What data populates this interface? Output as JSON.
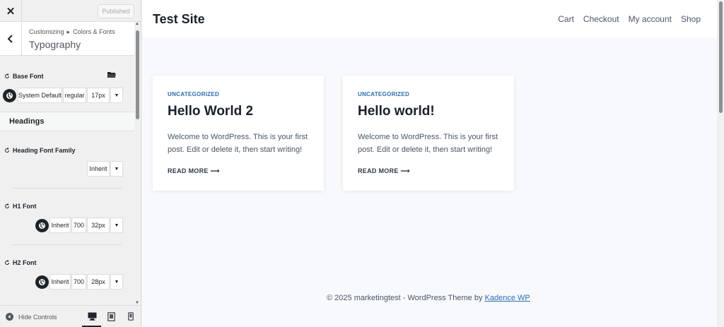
{
  "topbar": {
    "close_glyph": "✕",
    "publish_label": "Published"
  },
  "panel": {
    "breadcrumb_root": "Customizing",
    "breadcrumb_sep": "▸",
    "breadcrumb_parent": "Colors & Fonts",
    "section_title": "Typography"
  },
  "base_font": {
    "label": "Base Font",
    "family": "System Default",
    "weight": "regular",
    "size": "17px"
  },
  "headings": {
    "title": "Headings",
    "family_label": "Heading Font Family",
    "family_value": "Inherit",
    "h1": {
      "label": "H1 Font",
      "family": "Inherit",
      "weight": "700",
      "size": "32px"
    },
    "h2": {
      "label": "H2 Font",
      "family": "Inherit",
      "weight": "700",
      "size": "28px"
    }
  },
  "footer_controls": {
    "hide_label": "Hide Controls"
  },
  "site": {
    "title": "Test Site",
    "nav": [
      "Cart",
      "Checkout",
      "My account",
      "Shop"
    ]
  },
  "posts": [
    {
      "category": "UNCATEGORIZED",
      "title": "Hello World 2",
      "excerpt": "Welcome to WordPress. This is your first post. Edit or delete it, then start writing!",
      "read_more": "READ MORE ⟶"
    },
    {
      "category": "UNCATEGORIZED",
      "title": "Hello world!",
      "excerpt": "Welcome to WordPress. This is your first post. Edit or delete it, then start writing!",
      "read_more": "READ MORE ⟶"
    }
  ],
  "site_footer": {
    "text": "© 2025 marketingtest - WordPress Theme by",
    "link": "Kadence WP"
  },
  "colors": {
    "accent": "#2b6cb0",
    "sidebar_bg": "#f0f0f1",
    "preview_bg": "#f7f9fc"
  }
}
